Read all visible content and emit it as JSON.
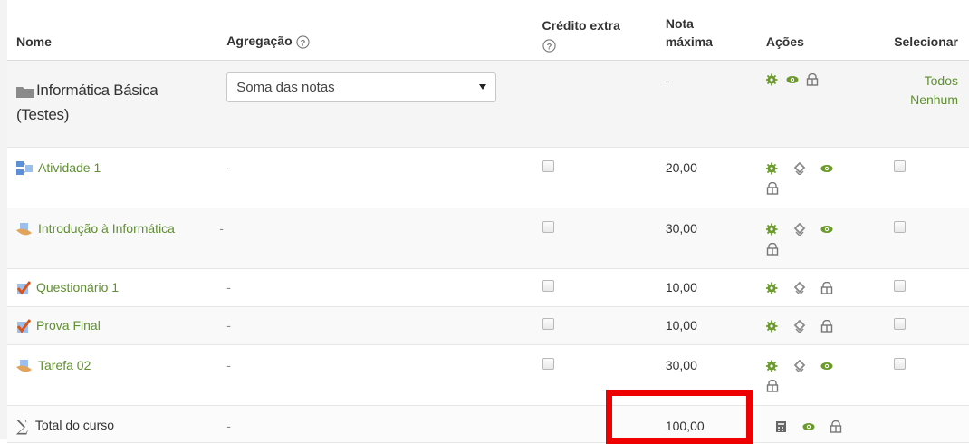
{
  "headers": {
    "name": "Nome",
    "aggregation": "Agregação",
    "extra_credit_line1": "Crédito extra",
    "max_grade_line1": "Nota",
    "max_grade_line2": "máxima",
    "actions": "Ações",
    "select": "Selecionar"
  },
  "category": {
    "name_line1": "Informática Básica",
    "name_line2": "(Testes)",
    "aggregation_value": "Soma das notas",
    "max_grade": "-",
    "select_all": "Todos",
    "select_none": "Nenhum"
  },
  "items": [
    {
      "name": "Atividade 1",
      "aggregation": "-",
      "max_grade": "20,00",
      "icon": "activity-icon"
    },
    {
      "name": "Introdução à Informática",
      "aggregation": "-",
      "max_grade": "30,00",
      "icon": "assignment-icon"
    },
    {
      "name": "Questionário 1",
      "aggregation": "-",
      "max_grade": "10,00",
      "icon": "quiz-icon"
    },
    {
      "name": "Prova Final",
      "aggregation": "-",
      "max_grade": "10,00",
      "icon": "quiz-icon"
    },
    {
      "name": "Tarefa 02",
      "aggregation": "-",
      "max_grade": "30,00",
      "icon": "assignment-icon"
    }
  ],
  "total": {
    "name": "Total do curso",
    "aggregation": "-",
    "max_grade": "100,00",
    "icon": "sigma-icon"
  },
  "colors": {
    "link": "#5f8f2f",
    "highlight": "#ee0000"
  }
}
